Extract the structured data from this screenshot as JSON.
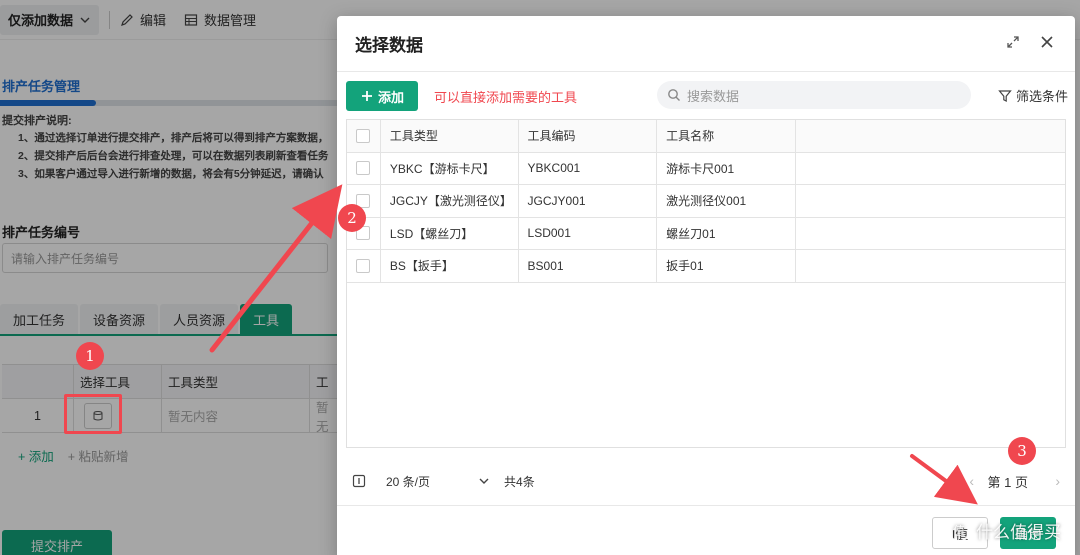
{
  "background": {
    "mode_select": "仅添加数据",
    "toolbar": {
      "edit": "编辑",
      "data_manage": "数据管理"
    },
    "section_title": "排产任务管理",
    "desc_title": "提交排产说明:",
    "desc_lines": [
      "1、通过选择订单进行提交排产，排产后将可以得到排产方案数据，",
      "2、提交排产后后台会进行排查处理，可以在数据列表刷新查看任务",
      "3、如果客户通过导入进行新增的数据，将会有5分钟延迟，请确认"
    ],
    "task_no_label": "排产任务编号",
    "task_no_placeholder": "请输入排产任务编号",
    "tabs": [
      "加工任务",
      "设备资源",
      "人员资源",
      "工具"
    ],
    "grid_headers": [
      "",
      "选择工具",
      "工具类型",
      "工"
    ],
    "grid_row": {
      "index": "1",
      "type": "暂无内容",
      "next": "暂无"
    },
    "add_label": "+ 添加",
    "paste_label": "+ 粘贴新增",
    "submit_label": "提交排产"
  },
  "modal": {
    "title": "选择数据",
    "add_button": "添加",
    "add_hint": "可以直接添加需要的工具",
    "search_placeholder": "搜索数据",
    "filter_label": "筛选条件",
    "columns": [
      "工具类型",
      "工具编码",
      "工具名称"
    ],
    "rows": [
      {
        "type": "YBKC【游标卡尺】",
        "code": "YBKC001",
        "name": "游标卡尺001"
      },
      {
        "type": "JGCJY【激光测径仪】",
        "code": "JGCJY001",
        "name": "激光测径仪001"
      },
      {
        "type": "LSD【螺丝刀】",
        "code": "LSD001",
        "name": "螺丝刀01"
      },
      {
        "type": "BS【扳手】",
        "code": "BS001",
        "name": "扳手01"
      }
    ],
    "pagination": {
      "page_size": "20 条/页",
      "total": "共4条",
      "current": "第 1 页",
      "prev": "‹",
      "next": "›"
    },
    "cancel_label": "I值",
    "ok_label": "确定"
  },
  "annotations": {
    "badges": [
      "1",
      "2",
      "3"
    ]
  },
  "watermark": {
    "circle": "值",
    "text": "什么值得买"
  },
  "colors": {
    "accent": "#13a37b",
    "annotation": "#f0474f",
    "link": "#1f6fd1"
  }
}
